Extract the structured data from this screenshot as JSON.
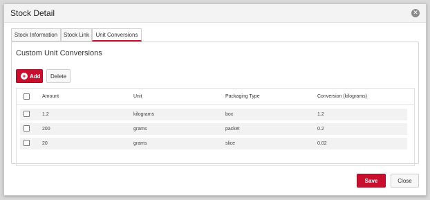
{
  "dialog": {
    "title": "Stock Detail",
    "close_icon": "close-icon"
  },
  "tabs": [
    {
      "label": "Stock Information",
      "active": false
    },
    {
      "label": "Stock Link",
      "active": false
    },
    {
      "label": "Unit Conversions",
      "active": true
    }
  ],
  "panel": {
    "title": "Custom Unit Conversions",
    "add_label": "Add",
    "add_icon": "plus-circle-icon",
    "delete_label": "Delete"
  },
  "grid": {
    "columns": [
      "Amount",
      "Unit",
      "Packaging Type",
      "Conversion (kilograms)"
    ],
    "rows": [
      {
        "amount": "1.2",
        "unit": "kilograms",
        "packaging": "box",
        "conversion": "1.2"
      },
      {
        "amount": "200",
        "unit": "grams",
        "packaging": "packet",
        "conversion": "0.2"
      },
      {
        "amount": "20",
        "unit": "grams",
        "packaging": "slice",
        "conversion": "0.02"
      }
    ]
  },
  "footer": {
    "save_label": "Save",
    "close_label": "Close"
  },
  "colors": {
    "accent": "#c8102e"
  }
}
